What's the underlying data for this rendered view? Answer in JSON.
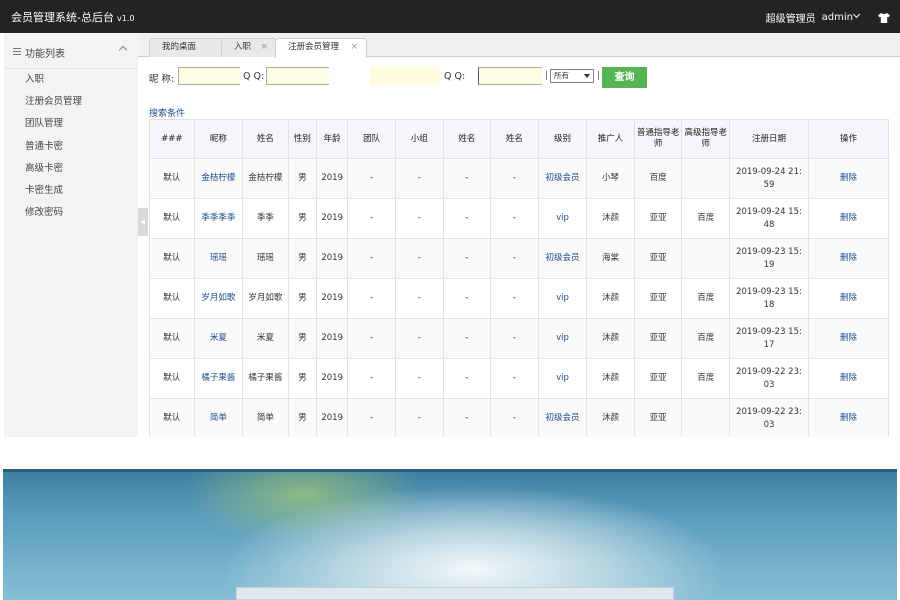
{
  "app": {
    "title": "会员管理系统-总后台",
    "version": "v1.0",
    "role": "超级管理员",
    "user": "admin"
  },
  "sidebar": {
    "title": "功能列表",
    "items": [
      {
        "label": "入职"
      },
      {
        "label": "注册会员管理"
      },
      {
        "label": "团队管理"
      },
      {
        "label": "普通卡密"
      },
      {
        "label": "高级卡密"
      },
      {
        "label": "卡密生成"
      },
      {
        "label": "修改密码"
      }
    ]
  },
  "tabs": [
    {
      "label": "我的桌面",
      "closable": false,
      "active": false
    },
    {
      "label": "入职",
      "closable": true,
      "active": false
    },
    {
      "label": "注册会员管理",
      "closable": true,
      "active": true
    }
  ],
  "close_glyph": "×",
  "search": {
    "nickname_label": "昵 称:",
    "qq1_label": "Q Q:",
    "qq2_label": "Q Q:",
    "pipe": "|",
    "select_value": "所有",
    "button_label": "查询"
  },
  "conditions_label": "搜索条件",
  "table": {
    "headers": [
      "###",
      "昵称",
      "姓名",
      "性别",
      "年龄",
      "团队",
      "小组",
      "姓名",
      "姓名",
      "级别",
      "推广人",
      "普通指导老师",
      "高级指导老师",
      "注册日期",
      "操作"
    ],
    "rows": [
      [
        "默认",
        "金桔柠檬",
        "金桔柠檬",
        "男",
        "2019",
        "-",
        "-",
        "-",
        "-",
        "初级会员",
        "小琴",
        "百度",
        "",
        "2019-09-24 21:59",
        "删除"
      ],
      [
        "默认",
        "季季季季",
        "季季",
        "男",
        "2019",
        "-",
        "-",
        "-",
        "-",
        "vip",
        "沐颜",
        "亚亚",
        "百度",
        "2019-09-24 15:48",
        "删除"
      ],
      [
        "默认",
        "瑶瑶",
        "瑶瑶",
        "男",
        "2019",
        "-",
        "-",
        "-",
        "-",
        "初级会员",
        "海棠",
        "亚亚",
        "",
        "2019-09-23 15:19",
        "删除"
      ],
      [
        "默认",
        "岁月如歌",
        "岁月如歌",
        "男",
        "2019",
        "-",
        "-",
        "-",
        "-",
        "vip",
        "沐颜",
        "亚亚",
        "百度",
        "2019-09-23 15:18",
        "删除"
      ],
      [
        "默认",
        "米夏",
        "米夏",
        "男",
        "2019",
        "-",
        "-",
        "-",
        "-",
        "vip",
        "沐颜",
        "亚亚",
        "百度",
        "2019-09-23 15:17",
        "删除"
      ],
      [
        "默认",
        "橘子果酱",
        "橘子果酱",
        "男",
        "2019",
        "-",
        "-",
        "-",
        "-",
        "vip",
        "沐颜",
        "亚亚",
        "百度",
        "2019-09-22 23:03",
        "删除"
      ],
      [
        "默认",
        "简单",
        "简单",
        "男",
        "2019",
        "-",
        "-",
        "-",
        "-",
        "初级会员",
        "沐颜",
        "亚亚",
        "",
        "2019-09-22 23:03",
        "删除"
      ]
    ]
  },
  "icons": {
    "user_menu": "chevron-down-icon",
    "skin": "shirt-icon",
    "sidebar": "list-icon",
    "collapse": "chevron-up-icon"
  },
  "colors": {
    "topbar": "#232323",
    "accent_button": "#56b452",
    "link": "#214e8c",
    "input_bg": "#fffde3"
  }
}
